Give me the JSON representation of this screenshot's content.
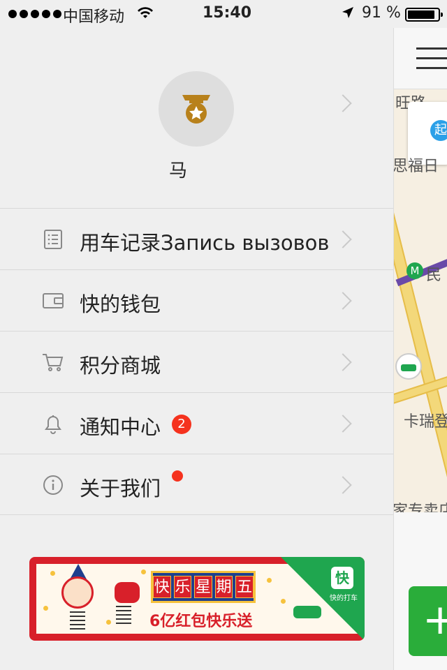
{
  "status_bar": {
    "carrier": "中国移动",
    "time": "15:40",
    "battery": "91 %"
  },
  "profile": {
    "name": "马",
    "medal_icon": "medal-star-icon"
  },
  "menu": [
    {
      "label": "用车记录Запись вызовов",
      "icon": "list-icon"
    },
    {
      "label": "快的钱包",
      "icon": "wallet-icon"
    },
    {
      "label": "积分商城",
      "icon": "cart-icon",
      "dot": true
    },
    {
      "label": "通知中心",
      "icon": "bell-icon",
      "badge": "2"
    },
    {
      "label": "关于我们",
      "icon": "info-icon"
    }
  ],
  "banner": {
    "title_chars": [
      "快",
      "乐",
      "星",
      "期",
      "五"
    ],
    "subtitle": "6亿红包快乐送",
    "logo_char": "快",
    "logo_text": "快的打车"
  },
  "map": {
    "labels": [
      "旺路",
      "思福日",
      "民",
      "卡瑞登",
      "家专卖店"
    ],
    "pin_text": "起",
    "metro_icon": "metro-icon"
  },
  "colors": {
    "accent_red": "#f5321e",
    "brand_green": "#1fa64f",
    "medal_gold": "#b8811b"
  }
}
